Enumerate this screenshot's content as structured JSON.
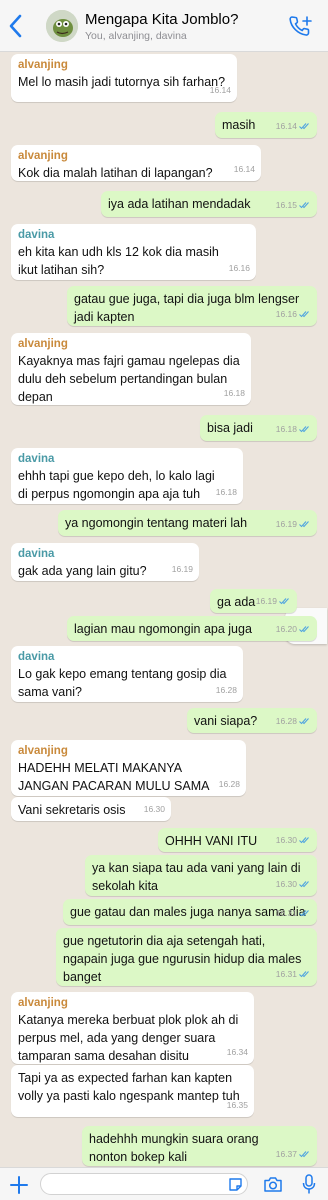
{
  "header": {
    "title": "Mengapa Kita Jomblo?",
    "subtitle": "You, alvanjing, davina"
  },
  "colors": {
    "accent": "#1f7aec",
    "incoming_bubble": "#ffffff",
    "outgoing_bubble": "#dcf8c6",
    "background": "#ece5dd",
    "alvanjing_name": "#c98a3c",
    "davina_name": "#4a9aa6",
    "read_ticks": "#4fa3e0"
  },
  "messages": [
    {
      "dir": "in",
      "sender": "alvanjing",
      "text": "Mel lo masih jadi tutornya sih farhan?",
      "time": "16.14"
    },
    {
      "dir": "out",
      "text": "masih",
      "time": "16.14",
      "ticks": "read"
    },
    {
      "dir": "in",
      "sender": "alvanjing",
      "text": "Kok dia malah latihan di lapangan?",
      "time": "16.14"
    },
    {
      "dir": "out",
      "text": "iya ada latihan mendadak",
      "time": "16.15",
      "ticks": "read"
    },
    {
      "dir": "in",
      "sender": "davina",
      "text": "eh kita kan udh kls 12 kok dia masih ikut latihan sih?",
      "time": "16.16"
    },
    {
      "dir": "out",
      "text": "gatau gue juga, tapi dia juga blm lengser jadi kapten",
      "time": "16.16",
      "ticks": "read"
    },
    {
      "dir": "in",
      "sender": "alvanjing",
      "text": "Kayaknya mas fajri gamau ngelepas dia dulu deh sebelum pertandingan bulan depan",
      "time": "16.18"
    },
    {
      "dir": "out",
      "text": "bisa jadi",
      "time": "16.18",
      "ticks": "read"
    },
    {
      "dir": "in",
      "sender": "davina",
      "text": "ehhh tapi gue kepo deh, lo kalo lagi di perpus ngomongin apa aja tuh",
      "time": "16.18"
    },
    {
      "dir": "out",
      "text": "ya ngomongin tentang materi lah",
      "time": "16.19",
      "ticks": "read"
    },
    {
      "dir": "in",
      "sender": "davina",
      "text": "gak ada yang lain gitu?",
      "time": "16.19"
    },
    {
      "dir": "out",
      "text": "ga ada",
      "time": "16.19",
      "ticks": "read"
    },
    {
      "dir": "out",
      "text": "lagian mau ngomongin apa juga",
      "time": "16.20",
      "ticks": "read"
    },
    {
      "dir": "in",
      "sender": "davina",
      "text": "Lo gak kepo emang tentang gosip dia sama vani?",
      "time": "16.28"
    },
    {
      "dir": "out",
      "text": "vani siapa?",
      "time": "16.28",
      "ticks": "read"
    },
    {
      "dir": "in",
      "sender": "alvanjing",
      "text": "HADEHH MELATI MAKANYA JANGAN PACARAN MULU SAMA BUKU",
      "time": "16.28"
    },
    {
      "dir": "in",
      "text": "Vani sekretaris osis",
      "time": "16.30"
    },
    {
      "dir": "out",
      "text": "OHHH VANI ITU",
      "time": "16.30",
      "ticks": "read"
    },
    {
      "dir": "out",
      "text": "ya kan siapa tau ada vani yang lain di sekolah kita",
      "time": "16.30",
      "ticks": "read"
    },
    {
      "dir": "out",
      "text": "gue gatau dan males juga nanya sama dia",
      "time": "16.31",
      "ticks": "read"
    },
    {
      "dir": "out",
      "text": "gue ngetutorin dia aja setengah hati, ngapain juga gue ngurusin hidup dia males banget",
      "time": "16.31",
      "ticks": "read"
    },
    {
      "dir": "in",
      "sender": "alvanjing",
      "text": "Katanya mereka berbuat plok plok ah di perpus mel, ada yang denger suara tamparan sama desahan disitu",
      "time": "16.34"
    },
    {
      "dir": "in",
      "text": "Tapi ya as expected farhan kan kapten volly ya pasti kalo ngespank mantep tuh",
      "time": "16.35"
    },
    {
      "dir": "out",
      "text": "hadehhh mungkin suara orang nonton bokep kali",
      "time": "16.37",
      "ticks": "read"
    }
  ],
  "input": {
    "placeholder": ""
  },
  "icons": {
    "back": "chevron-left-icon",
    "call": "add-call-icon",
    "scroll": "chevron-down-icon",
    "plus": "plus-icon",
    "sticker": "sticker-icon",
    "camera": "camera-icon",
    "mic": "microphone-icon"
  }
}
